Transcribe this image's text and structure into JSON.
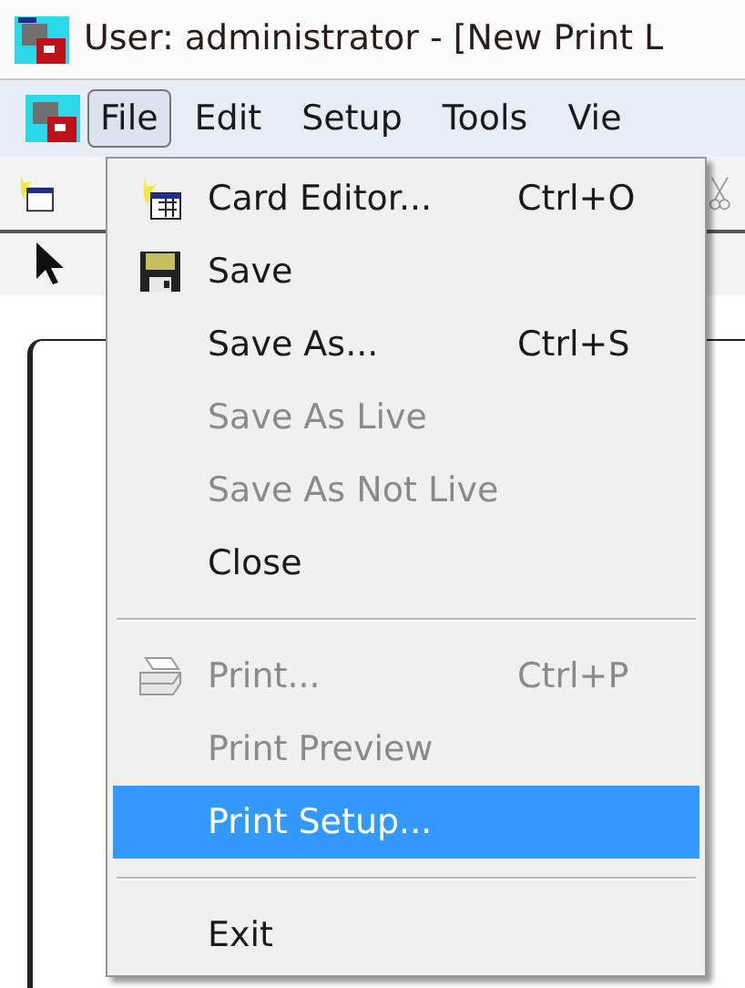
{
  "window": {
    "title": "User: administrator - [New Print L"
  },
  "menu_bar": [
    {
      "label": "File",
      "selected": true
    },
    {
      "label": "Edit",
      "selected": false
    },
    {
      "label": "Setup",
      "selected": false
    },
    {
      "label": "Tools",
      "selected": false
    },
    {
      "label": "Vie",
      "selected": false
    }
  ],
  "file_menu": [
    {
      "kind": "item",
      "label": "Card Editor...",
      "shortcut": "Ctrl+O",
      "disabled": false,
      "selected": false
    },
    {
      "kind": "item",
      "label": "Save",
      "disabled": false,
      "selected": false
    },
    {
      "kind": "item",
      "label": "Save As...",
      "shortcut": "Ctrl+S",
      "disabled": false,
      "selected": false
    },
    {
      "kind": "item",
      "label": "Save As Live",
      "disabled": true,
      "selected": false
    },
    {
      "kind": "item",
      "label": "Save As Not Live",
      "disabled": true,
      "selected": false
    },
    {
      "kind": "item",
      "label": "Close",
      "disabled": false,
      "selected": false
    },
    {
      "kind": "separator"
    },
    {
      "kind": "item",
      "label": "Print...",
      "shortcut": "Ctrl+P",
      "disabled": true,
      "selected": false
    },
    {
      "kind": "item",
      "label": "Print Preview",
      "disabled": true,
      "selected": false
    },
    {
      "kind": "item",
      "label": "Print Setup...",
      "disabled": false,
      "selected": true
    },
    {
      "kind": "separator"
    },
    {
      "kind": "item",
      "label": "Exit",
      "disabled": false,
      "selected": false
    }
  ]
}
